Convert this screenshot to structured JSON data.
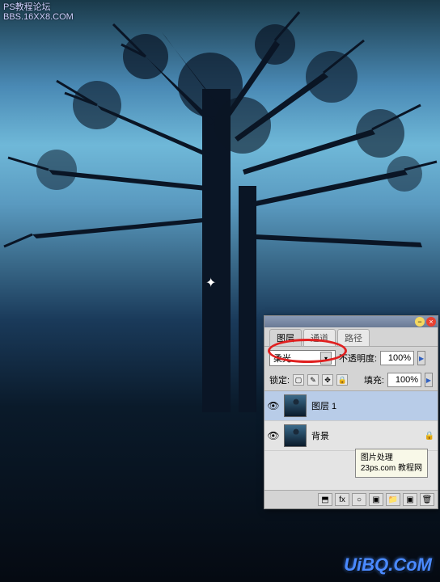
{
  "watermark_top": {
    "line1": "PS教程论坛",
    "line2": "BBS.16XX8.COM"
  },
  "watermark_bottom": "UiBQ.CoM",
  "crosshair": "✦",
  "panel": {
    "tabs": [
      "图层",
      "通道",
      "路径"
    ],
    "active_tab": 0,
    "blend_label": "柔光",
    "opacity_label": "不透明度:",
    "opacity_value": "100%",
    "lock_label": "锁定:",
    "fill_label": "填充:",
    "fill_value": "100%",
    "lock_icons": [
      "▢",
      "✎",
      "✥",
      "🔒"
    ]
  },
  "layers": [
    {
      "visible": true,
      "name": "图层 1",
      "locked": false,
      "selected": true
    },
    {
      "visible": true,
      "name": "背景",
      "locked": true,
      "selected": false
    }
  ],
  "tooltip": {
    "line1": "图片处理",
    "line2a": "23ps.com",
    "line2b": "教程网"
  },
  "footer_icons": [
    "⬒",
    "fx",
    "○",
    "▣",
    "📁",
    "▣",
    "🗑"
  ]
}
